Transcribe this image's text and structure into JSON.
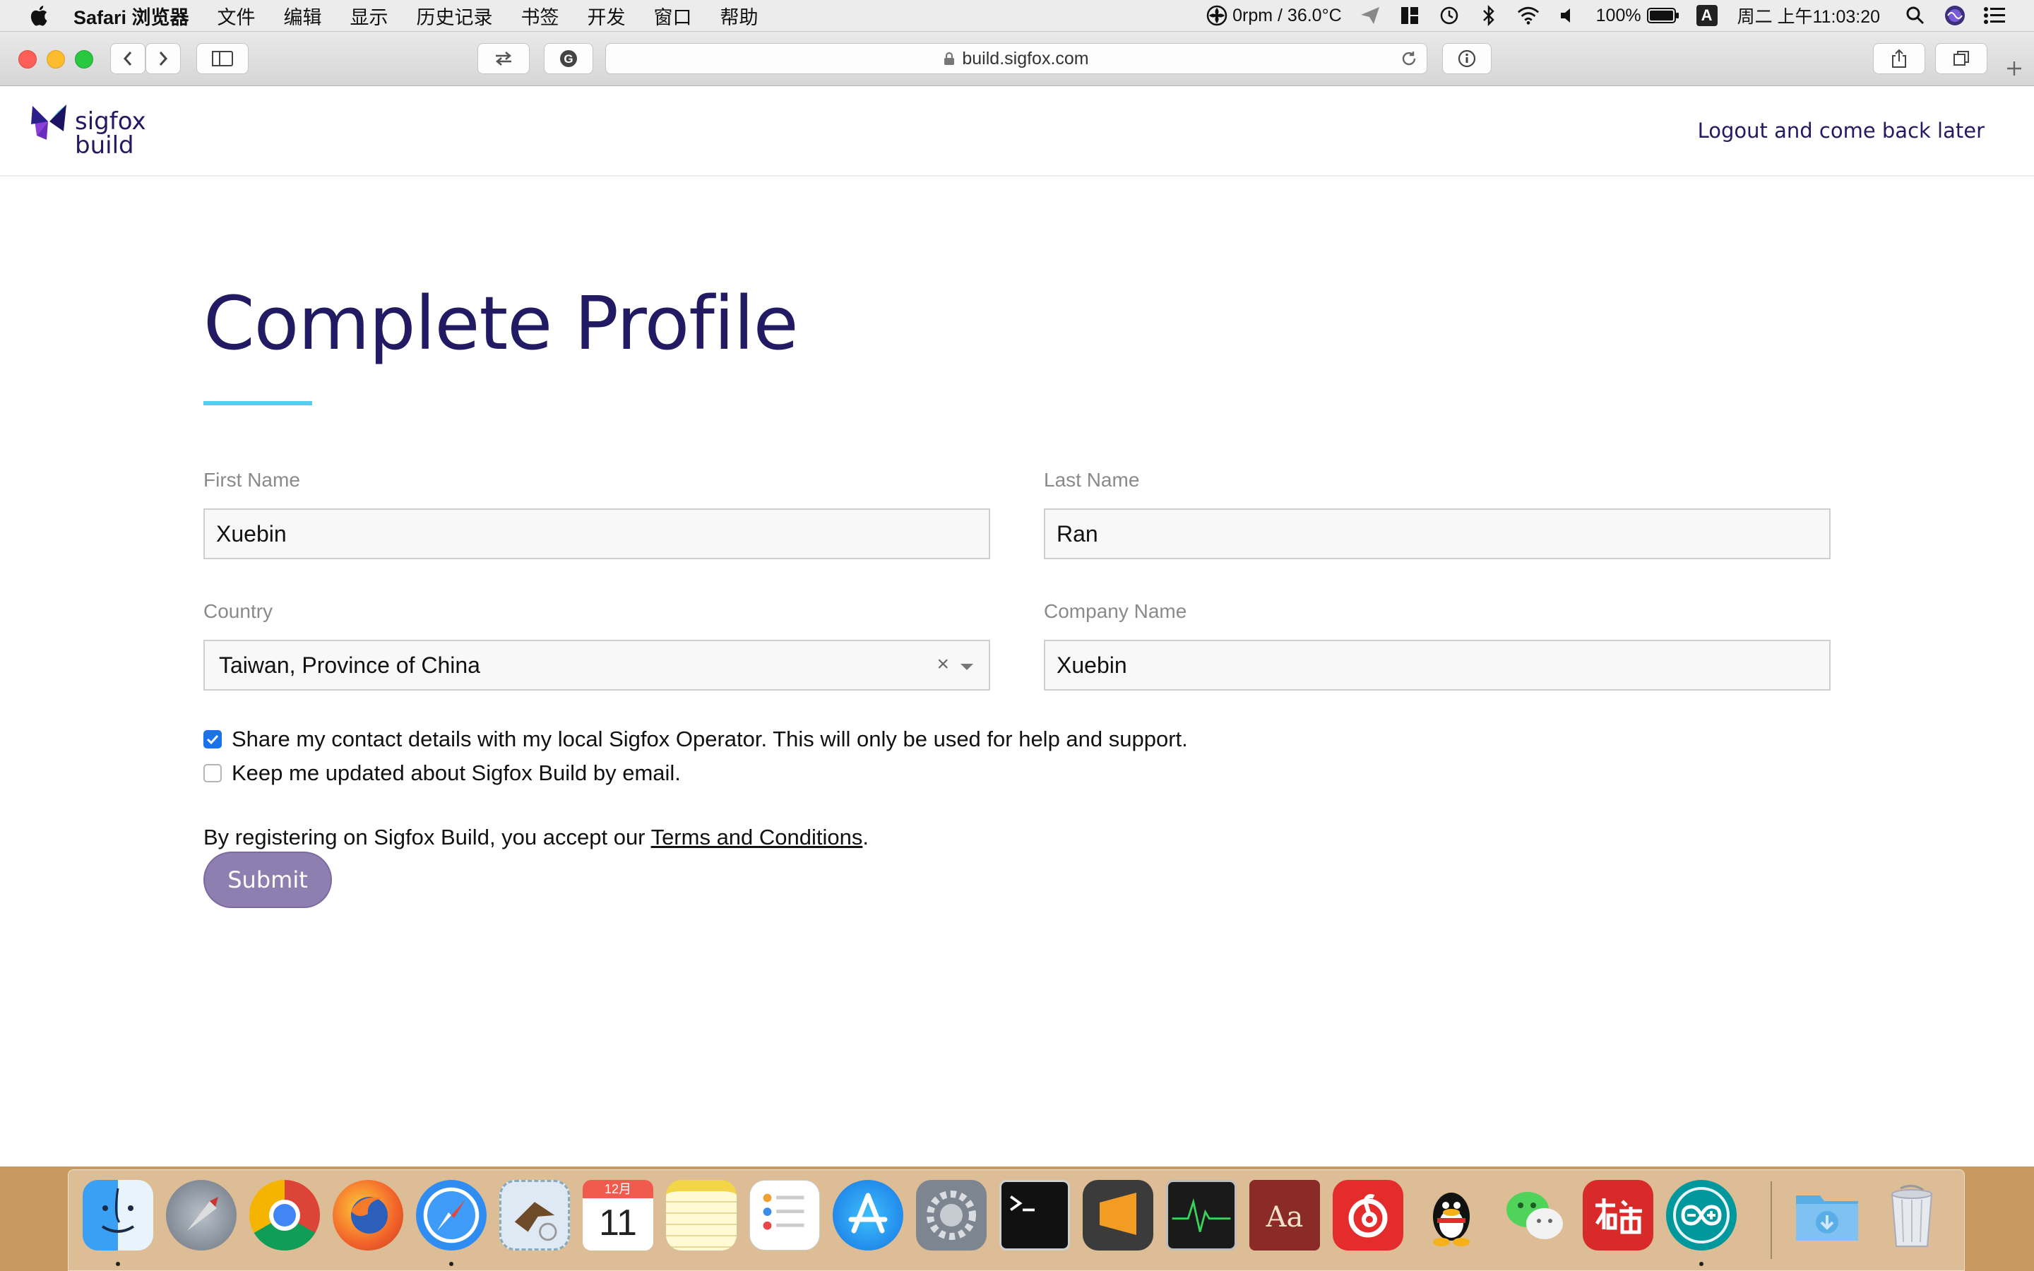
{
  "menubar": {
    "app_name": "Safari 浏览器",
    "menus": [
      "文件",
      "编辑",
      "显示",
      "历史记录",
      "书签",
      "开发",
      "窗口",
      "帮助"
    ],
    "fan_status": "0rpm / 36.0°C",
    "battery": "100%",
    "input_method": "A",
    "datetime": "周二 上午11:03:20"
  },
  "browser": {
    "url": "build.sigfox.com"
  },
  "site": {
    "logo_line1": "sigfox",
    "logo_line2": "build",
    "logout_label": "Logout and come back later"
  },
  "form": {
    "title": "Complete Profile",
    "first_name_label": "First Name",
    "first_name_value": "Xuebin",
    "last_name_label": "Last Name",
    "last_name_value": "Ran",
    "country_label": "Country",
    "country_value": "Taiwan, Province of China",
    "country_clear": "×",
    "company_label": "Company Name",
    "company_value": "Xuebin",
    "share_contact_label": "Share my contact details with my local Sigfox Operator. This will only be used for help and support.",
    "share_contact_checked": true,
    "updates_label": "Keep me updated about Sigfox Build by email.",
    "updates_checked": false,
    "terms_prefix": "By registering on Sigfox Build, you accept our ",
    "terms_link": "Terms and Conditions",
    "terms_suffix": ".",
    "submit_label": "Submit"
  },
  "colors": {
    "brand_navy": "#221a63",
    "accent_cyan": "#5dcaf0",
    "submit_purple": "#8f7fb1",
    "checkbox_blue": "#1a73e8"
  },
  "calendar": {
    "month": "12月",
    "day": "11"
  },
  "dock_icons": [
    "finder-icon",
    "launchpad-icon",
    "chrome-icon",
    "firefox-icon",
    "safari-icon",
    "mail-icon",
    "calendar-icon",
    "notes-icon",
    "reminders-icon",
    "app-store-icon",
    "system-preferences-icon",
    "terminal-icon",
    "sublime-text-icon",
    "activity-monitor-icon",
    "dictionary-icon",
    "netease-music-icon",
    "qq-icon",
    "wechat-icon",
    "youdao-icon",
    "arduino-icon",
    "downloads-folder-icon",
    "trash-icon"
  ]
}
